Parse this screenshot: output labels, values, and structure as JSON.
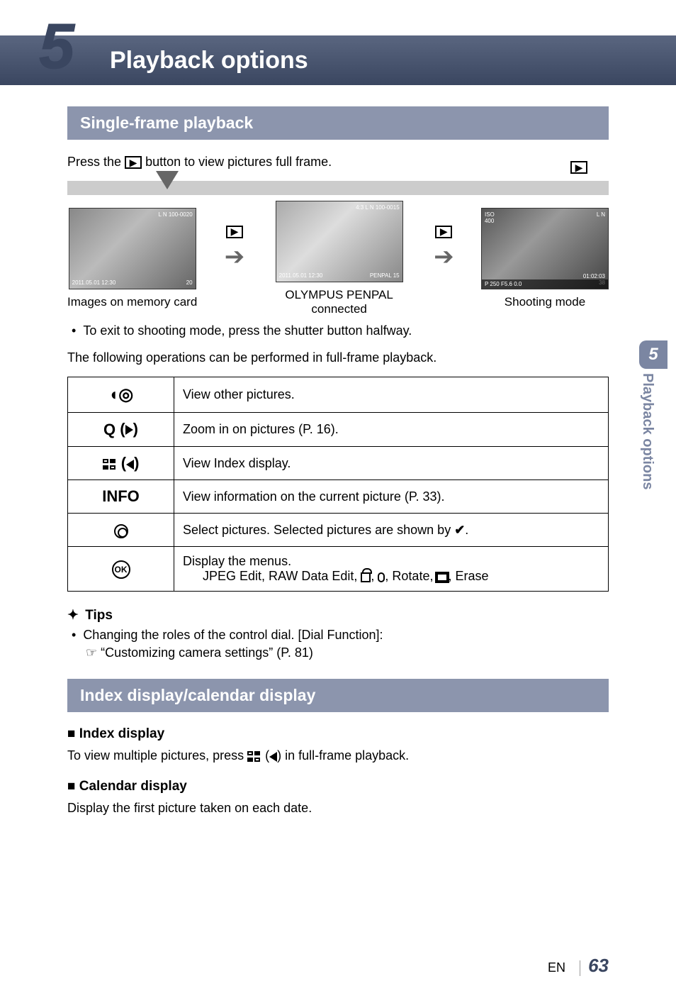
{
  "chapter": {
    "number": "5",
    "title": "Playback options"
  },
  "sidebar": {
    "number": "5",
    "label": "Playback options"
  },
  "section1": {
    "title": "Single-frame playback",
    "intro_pre": "Press the ",
    "intro_post": " button to view pictures full frame.",
    "fig1": {
      "caption": "Images on memory card",
      "bl": "2011.05.01 12:30",
      "tr1": "L N 100-0020",
      "br": "20"
    },
    "fig2": {
      "caption": "OLYMPUS PENPAL connected",
      "bl": "2011.05.01 12:30",
      "tr1": "4:3   L N     100-0015",
      "br": "PENPAL 15"
    },
    "fig3": {
      "caption": "Shooting mode",
      "tl": "ISO\n400",
      "bar": "P      250   F5.6    0.0",
      "tr1": "L N",
      "br1": "01:02:03",
      "br2": "38"
    },
    "bullet1": "To exit to shooting mode, press the shutter button halfway.",
    "ops_intro": "The following operations can be performed in full-frame playback."
  },
  "table": {
    "r1": "View other pictures.",
    "r2": "Zoom in on pictures (P. 16).",
    "r3": "View Index display.",
    "r4_label": "INFO",
    "r4": "View information on the current picture (P. 33).",
    "r5_pre": "Select pictures. Selected pictures are shown by ",
    "r5_post": ".",
    "r6a": "Display the menus.",
    "r6b_pre": "JPEG Edit, RAW Data Edit, ",
    "r6b_mid": ", Rotate, ",
    "r6b_end": ", Erase"
  },
  "tips": {
    "heading": "Tips",
    "line1": "Changing the roles of the control dial. [Dial Function]:",
    "line2": "“Customizing camera settings” (P. 81)"
  },
  "section2": {
    "title": "Index display/calendar display",
    "sub1": "Index display",
    "sub1_text_pre": "To view multiple pictures, press ",
    "sub1_text_post": ") in full-frame playback.",
    "sub2": "Calendar display",
    "sub2_text": "Display the first picture taken on each date."
  },
  "footer": {
    "lang": "EN",
    "page": "63"
  }
}
